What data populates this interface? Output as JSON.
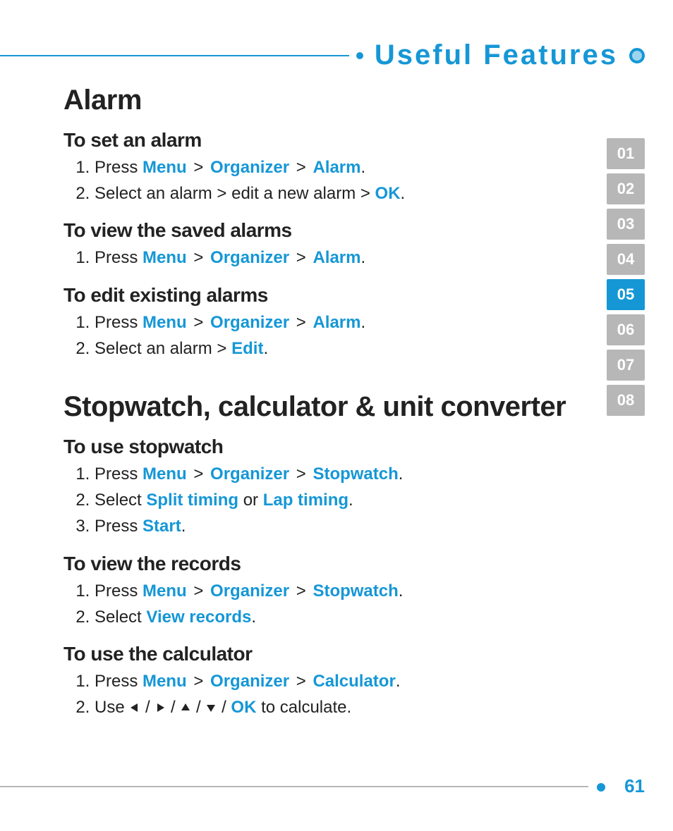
{
  "header": {
    "title": "Useful Features"
  },
  "sections": {
    "alarm": {
      "heading": "Alarm",
      "set": {
        "title": "To set an alarm",
        "step1_a": "Press ",
        "step1_menu": "Menu",
        "step1_gt1": " > ",
        "step1_org": "Organizer",
        "step1_gt2": " > ",
        "step1_alarm": "Alarm",
        "step1_z": ".",
        "step2_a": "Select an alarm > edit a new alarm > ",
        "step2_ok": "OK",
        "step2_z": "."
      },
      "view": {
        "title": "To view the saved alarms",
        "step1_a": "Press ",
        "step1_menu": "Menu",
        "step1_gt1": " > ",
        "step1_org": "Organizer",
        "step1_gt2": " > ",
        "step1_alarm": "Alarm",
        "step1_z": "."
      },
      "edit": {
        "title": "To edit existing alarms",
        "step1_a": "Press ",
        "step1_menu": "Menu",
        "step1_gt1": " > ",
        "step1_org": "Organizer",
        "step1_gt2": " > ",
        "step1_alarm": "Alarm",
        "step1_z": ".",
        "step2_a": "Select an alarm > ",
        "step2_edit": "Edit",
        "step2_z": "."
      }
    },
    "tools": {
      "heading": "Stopwatch, calculator & unit converter",
      "stopwatch": {
        "title": "To use stopwatch",
        "step1_a": "Press ",
        "step1_menu": "Menu",
        "step1_gt1": " > ",
        "step1_org": "Organizer",
        "step1_gt2": " > ",
        "step1_sw": "Stopwatch",
        "step1_z": ".",
        "step2_a": "Select ",
        "step2_split": "Split timing",
        "step2_or": " or ",
        "step2_lap": "Lap timing",
        "step2_z": ".",
        "step3_a": "Press ",
        "step3_start": "Start",
        "step3_z": "."
      },
      "records": {
        "title": "To view the records",
        "step1_a": "Press ",
        "step1_menu": "Menu",
        "step1_gt1": " > ",
        "step1_org": "Organizer",
        "step1_gt2": " > ",
        "step1_sw": "Stopwatch",
        "step1_z": ".",
        "step2_a": "Select ",
        "step2_vr": "View records",
        "step2_z": "."
      },
      "calculator": {
        "title": "To use the calculator",
        "step1_a": "Press ",
        "step1_menu": "Menu",
        "step1_gt1": " > ",
        "step1_org": "Organizer",
        "step1_gt2": " > ",
        "step1_calc": "Calculator",
        "step1_z": ".",
        "step2_a": "Use ",
        "step2_slash1": " / ",
        "step2_slash2": " / ",
        "step2_slash3": " / ",
        "step2_slash4": " / ",
        "step2_ok": "OK",
        "step2_z": " to calculate."
      }
    }
  },
  "nav": {
    "tabs": [
      "01",
      "02",
      "03",
      "04",
      "05",
      "06",
      "07",
      "08"
    ],
    "active": "05"
  },
  "page_number": "61"
}
